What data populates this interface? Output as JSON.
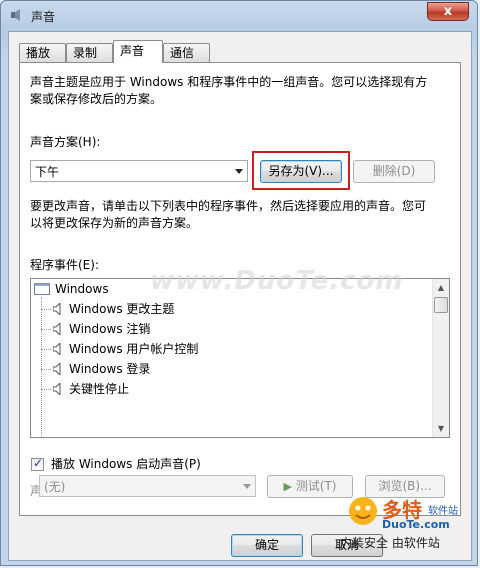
{
  "window": {
    "title": "声音",
    "close_label": "x"
  },
  "tabs": [
    {
      "label": "播放"
    },
    {
      "label": "录制"
    },
    {
      "label": "声音"
    },
    {
      "label": "通信"
    }
  ],
  "intro_text_line1": "声音主题是应用于 Windows 和程序事件中的一组声音。您可以选择现有方",
  "intro_text_line2": "案或保存修改后的方案。",
  "scheme": {
    "label": "声音方案(H):",
    "selected": "下午",
    "save_as_label": "另存为(V)...",
    "delete_label": "删除(D)"
  },
  "change_text_line1": "要更改声音，请单击以下列表中的程序事件，然后选择要应用的声音。您可",
  "change_text_line2": "以将更改保存为新的声音方案。",
  "events": {
    "label": "程序事件(E):",
    "root": "Windows",
    "items": [
      "Windows 更改主题",
      "Windows 注销",
      "Windows 用户帐户控制",
      "Windows 登录",
      "关键性停止"
    ]
  },
  "startup_checkbox_label": "播放 Windows 启动声音(P)",
  "startup_checked": true,
  "sound": {
    "label": "声音(S):",
    "selected": "(无)",
    "test_label": "测试(T)",
    "browse_label": "浏览(B)..."
  },
  "buttons": {
    "ok": "确定",
    "cancel": "取消"
  },
  "watermark": "www.DuoTe.com",
  "logo": {
    "main": "多特",
    "small": "软件站",
    "domain": "DuoTe.com",
    "slogan": "内装安全 由软件站"
  },
  "colors": {
    "highlight": "#cc1f1f",
    "title_bar": "#b7cbe3",
    "close_button": "#cf5a45"
  }
}
